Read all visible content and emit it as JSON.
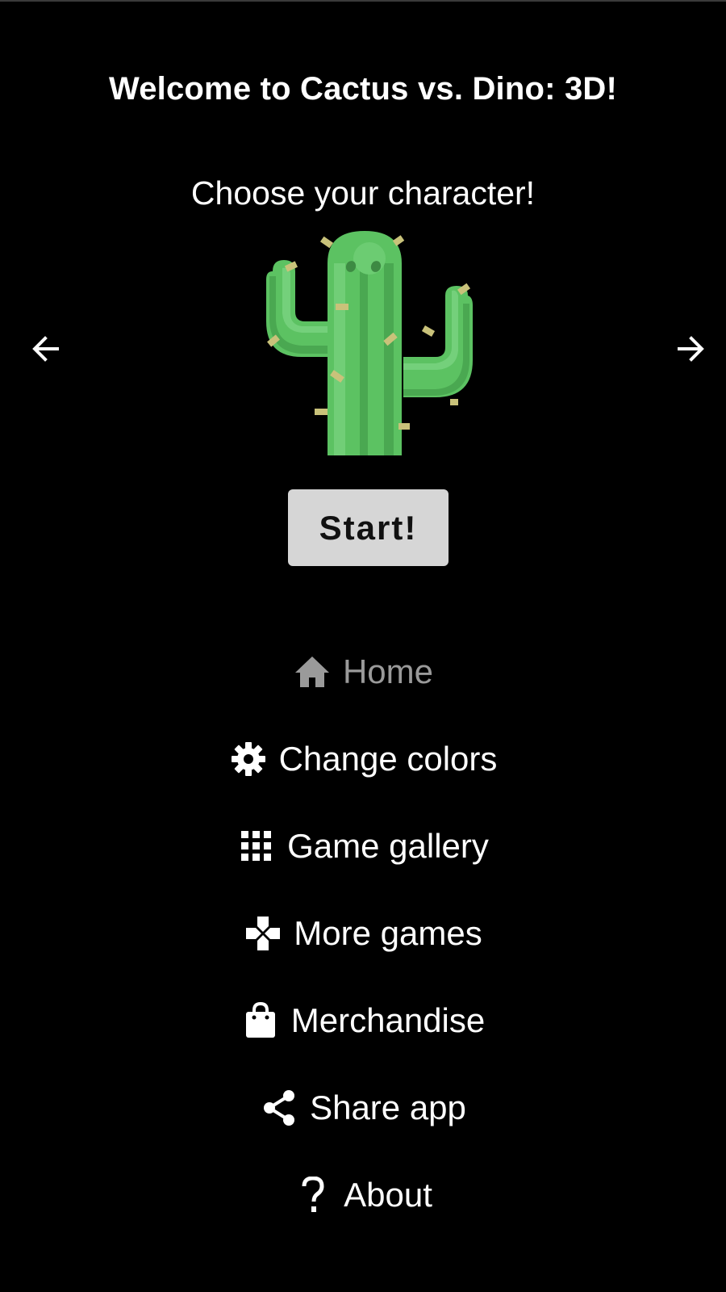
{
  "header": {
    "title": "Welcome to Cactus vs. Dino: 3D!",
    "subtitle": "Choose your character!"
  },
  "character_selector": {
    "selected_character": "cactus",
    "prev_icon": "arrow-left-icon",
    "next_icon": "arrow-right-icon"
  },
  "start_button": {
    "label": "Start!"
  },
  "menu": {
    "items": [
      {
        "label": "Home",
        "icon": "home-icon",
        "active": true
      },
      {
        "label": "Change colors",
        "icon": "gear-icon",
        "active": false
      },
      {
        "label": "Game gallery",
        "icon": "grid-icon",
        "active": false
      },
      {
        "label": "More games",
        "icon": "gamepad-icon",
        "active": false
      },
      {
        "label": "Merchandise",
        "icon": "shopping-bag-icon",
        "active": false
      },
      {
        "label": "Share app",
        "icon": "share-icon",
        "active": false
      },
      {
        "label": "About",
        "icon": "question-icon",
        "active": false
      }
    ]
  },
  "colors": {
    "background": "#000000",
    "text": "#ffffff",
    "active_menu_text": "#9a9a9a",
    "button_bg": "#d6d6d6",
    "cactus_green": "#5cc262"
  }
}
